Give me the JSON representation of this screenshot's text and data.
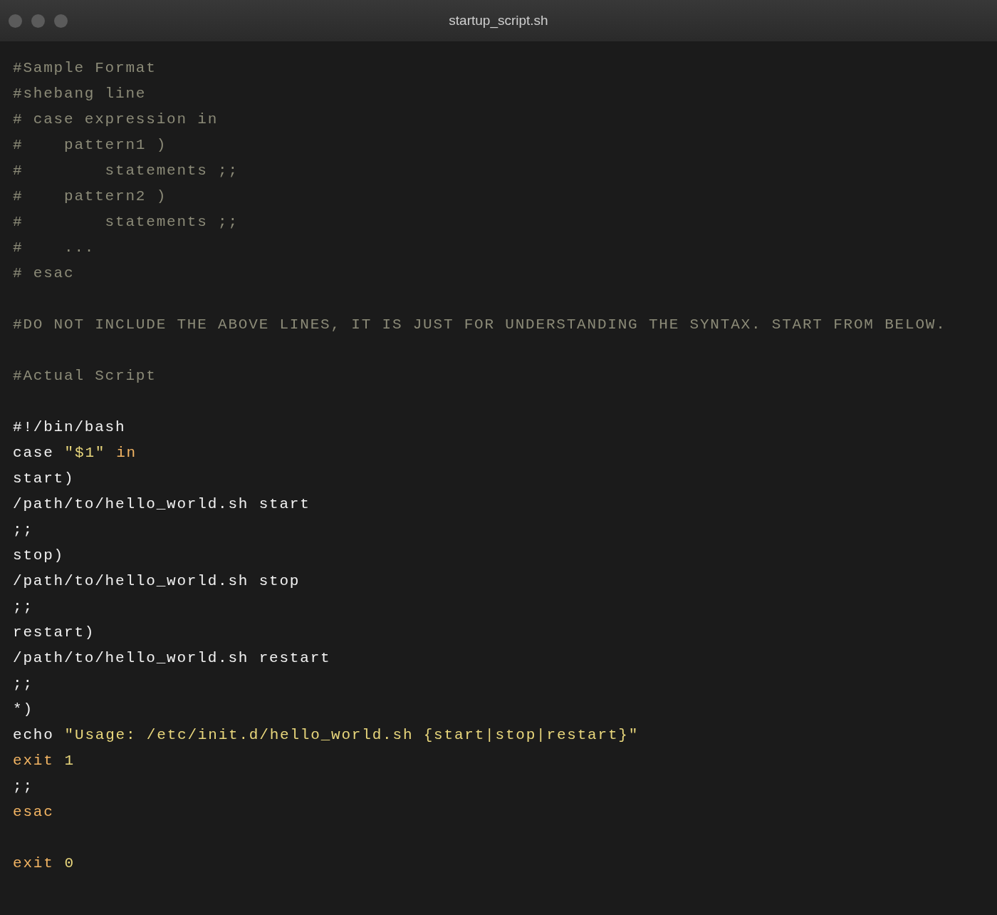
{
  "window": {
    "title": "startup_script.sh"
  },
  "editor": {
    "lines": [
      {
        "kind": "code",
        "tokens": [
          {
            "text": "#Sample Format",
            "kind": "comment"
          }
        ]
      },
      {
        "kind": "code",
        "tokens": [
          {
            "text": "#shebang line",
            "kind": "comment"
          }
        ]
      },
      {
        "kind": "code",
        "tokens": [
          {
            "text": "# case expression in",
            "kind": "comment"
          }
        ]
      },
      {
        "kind": "code",
        "tokens": [
          {
            "text": "#    pattern1 )",
            "kind": "comment"
          }
        ]
      },
      {
        "kind": "code",
        "tokens": [
          {
            "text": "#        statements ;;",
            "kind": "comment"
          }
        ]
      },
      {
        "kind": "code",
        "tokens": [
          {
            "text": "#    pattern2 )",
            "kind": "comment"
          }
        ]
      },
      {
        "kind": "code",
        "tokens": [
          {
            "text": "#        statements ;;",
            "kind": "comment"
          }
        ]
      },
      {
        "kind": "code",
        "tokens": [
          {
            "text": "#    ...",
            "kind": "comment"
          }
        ]
      },
      {
        "kind": "code",
        "tokens": [
          {
            "text": "# esac",
            "kind": "comment"
          }
        ]
      },
      {
        "kind": "blank"
      },
      {
        "kind": "code",
        "tokens": [
          {
            "text": "#DO NOT INCLUDE THE ABOVE LINES, IT IS JUST FOR UNDERSTANDING THE SYNTAX. START FROM BELOW.",
            "kind": "comment"
          }
        ]
      },
      {
        "kind": "blank"
      },
      {
        "kind": "code",
        "tokens": [
          {
            "text": "#Actual Script",
            "kind": "comment"
          }
        ]
      },
      {
        "kind": "blank"
      },
      {
        "kind": "code",
        "tokens": [
          {
            "text": "#!/bin/bash",
            "kind": "plain"
          }
        ]
      },
      {
        "kind": "code",
        "tokens": [
          {
            "text": "case",
            "kind": "plain"
          },
          {
            "text": "\"$1\"",
            "kind": "string"
          },
          {
            "text": "in",
            "kind": "keyword"
          }
        ]
      },
      {
        "kind": "code",
        "tokens": [
          {
            "text": "start)",
            "kind": "plain"
          }
        ]
      },
      {
        "kind": "code",
        "tokens": [
          {
            "text": "/path/to/hello_world.sh start",
            "kind": "plain"
          }
        ]
      },
      {
        "kind": "code",
        "tokens": [
          {
            "text": ";;",
            "kind": "plain"
          }
        ]
      },
      {
        "kind": "code",
        "tokens": [
          {
            "text": "stop)",
            "kind": "plain"
          }
        ]
      },
      {
        "kind": "code",
        "tokens": [
          {
            "text": "/path/to/hello_world.sh stop",
            "kind": "plain"
          }
        ]
      },
      {
        "kind": "code",
        "tokens": [
          {
            "text": ";;",
            "kind": "plain"
          }
        ]
      },
      {
        "kind": "code",
        "tokens": [
          {
            "text": "restart)",
            "kind": "plain"
          }
        ]
      },
      {
        "kind": "code",
        "tokens": [
          {
            "text": "/path/to/hello_world.sh restart",
            "kind": "plain"
          }
        ]
      },
      {
        "kind": "code",
        "tokens": [
          {
            "text": ";;",
            "kind": "plain"
          }
        ]
      },
      {
        "kind": "code",
        "tokens": [
          {
            "text": "*)",
            "kind": "plain"
          }
        ]
      },
      {
        "kind": "code",
        "tokens": [
          {
            "text": "echo",
            "kind": "plain"
          },
          {
            "text": "\"Usage: /etc/init.d/hello_world.sh {start|stop|restart}\"",
            "kind": "string"
          }
        ]
      },
      {
        "kind": "code",
        "tokens": [
          {
            "text": "exit",
            "kind": "keyword"
          },
          {
            "text": "1",
            "kind": "number"
          }
        ]
      },
      {
        "kind": "code",
        "tokens": [
          {
            "text": ";;",
            "kind": "plain"
          }
        ]
      },
      {
        "kind": "code",
        "tokens": [
          {
            "text": "esac",
            "kind": "keyword"
          }
        ]
      },
      {
        "kind": "blank"
      },
      {
        "kind": "code",
        "tokens": [
          {
            "text": "exit",
            "kind": "keyword"
          },
          {
            "text": "0",
            "kind": "number"
          }
        ]
      }
    ]
  }
}
